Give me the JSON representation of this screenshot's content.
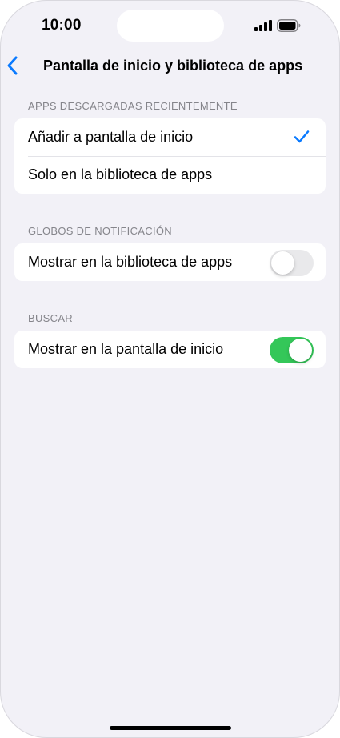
{
  "status_bar": {
    "time": "10:00"
  },
  "nav": {
    "title": "Pantalla de inicio y biblioteca de apps"
  },
  "sections": [
    {
      "header": "APPS DESCARGADAS RECIENTEMENTE",
      "rows": [
        {
          "label": "Añadir a pantalla de inicio",
          "selected": true
        },
        {
          "label": "Solo en la biblioteca de apps",
          "selected": false
        }
      ]
    },
    {
      "header": "GLOBOS DE NOTIFICACIÓN",
      "rows": [
        {
          "label": "Mostrar en la biblioteca de apps",
          "toggle": "off"
        }
      ]
    },
    {
      "header": "BUSCAR",
      "rows": [
        {
          "label": "Mostrar en la pantalla de inicio",
          "toggle": "on"
        }
      ]
    }
  ],
  "colors": {
    "accent": "#0a7aff",
    "toggle_on": "#34c759",
    "background": "#f2f1f7"
  }
}
